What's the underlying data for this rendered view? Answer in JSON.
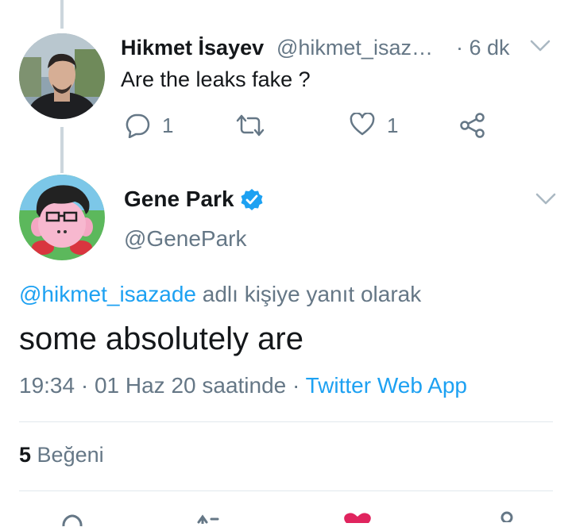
{
  "reply_tweet": {
    "author_name": "Hikmet İsayev",
    "handle": "@hikmet_isaz…",
    "time": "· 6 dk",
    "text": "Are the leaks fake ?",
    "reply_count": "1",
    "like_count": "1"
  },
  "main_tweet": {
    "author_name": "Gene Park",
    "handle": "@GenePark",
    "reply_to_handle": "@hikmet_isazade",
    "reply_to_suffix": "adlı kişiye yanıt olarak",
    "text": "some absolutely are",
    "time": "19:34 · 01 Haz 20 saatinde ·",
    "client": "Twitter Web App",
    "likes_count": "5",
    "likes_label": "Beğeni"
  },
  "icons": [
    "chevron-down-icon",
    "reply-icon",
    "retweet-icon",
    "like-icon",
    "share-icon",
    "verified-badge-icon"
  ],
  "colors": {
    "accent": "#1da1f2",
    "muted": "#657786",
    "divider": "#e1e8ed",
    "like": "#e0245e"
  }
}
